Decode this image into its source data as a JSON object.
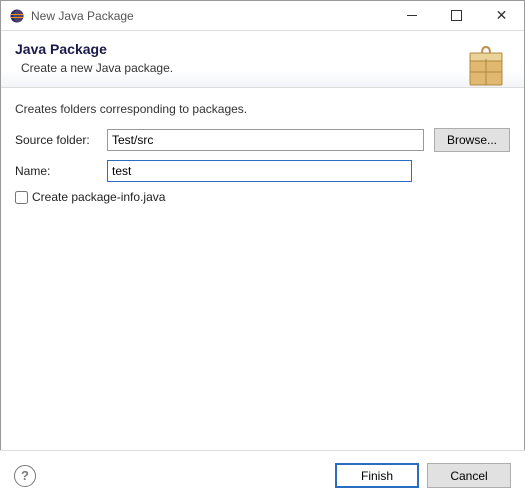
{
  "window": {
    "title": "New Java Package"
  },
  "header": {
    "title": "Java Package",
    "subtitle": "Create a new Java package."
  },
  "body": {
    "description": "Creates folders corresponding to packages.",
    "source_folder": {
      "label": "Source folder:",
      "value": "Test/src",
      "browse_label": "Browse..."
    },
    "name": {
      "label": "Name:",
      "value": "test"
    },
    "create_pkg_info": {
      "label": "Create package-info.java",
      "checked": false
    }
  },
  "footer": {
    "finish_label": "Finish",
    "cancel_label": "Cancel"
  }
}
